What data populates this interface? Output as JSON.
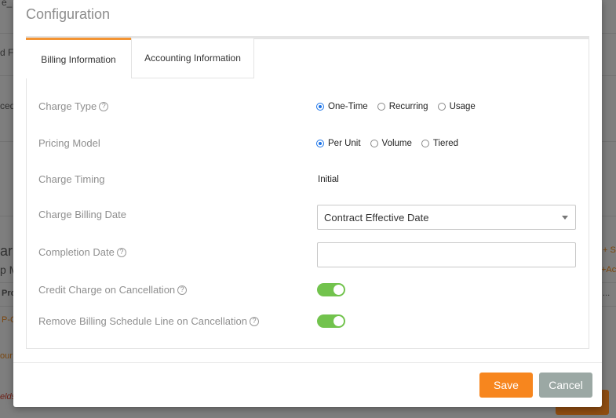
{
  "background": {
    "fragments": [
      "e_",
      "d Fi",
      "ced",
      "ar",
      "p M",
      "Pro",
      "P-C",
      "our",
      "elds",
      "+ S",
      "+Ac",
      "..."
    ]
  },
  "modal": {
    "title": "Configuration",
    "tabs": [
      {
        "label": "Billing Information",
        "active": true
      },
      {
        "label": "Accounting Information",
        "active": false
      }
    ],
    "fields": {
      "charge_type": {
        "label": "Charge Type",
        "options": [
          "One-Time",
          "Recurring",
          "Usage"
        ],
        "selected": "One-Time"
      },
      "pricing_model": {
        "label": "Pricing Model",
        "options": [
          "Per Unit",
          "Volume",
          "Tiered"
        ],
        "selected": "Per Unit"
      },
      "charge_timing": {
        "label": "Charge Timing",
        "value": "Initial"
      },
      "charge_billing_date": {
        "label": "Charge Billing Date",
        "value": "Contract Effective Date"
      },
      "completion_date": {
        "label": "Completion Date",
        "value": ""
      },
      "credit_charge_on_cancellation": {
        "label": "Credit Charge on Cancellation",
        "enabled": true
      },
      "remove_billing_schedule_line": {
        "label": "Remove Billing Schedule Line on Cancellation",
        "enabled": true
      }
    },
    "buttons": {
      "save": "Save",
      "cancel": "Cancel"
    }
  },
  "colors": {
    "accent": "#f7861e",
    "toggle_on": "#72c34d",
    "radio_selected": "#1a73e8",
    "cancel": "#9ba8a4"
  }
}
